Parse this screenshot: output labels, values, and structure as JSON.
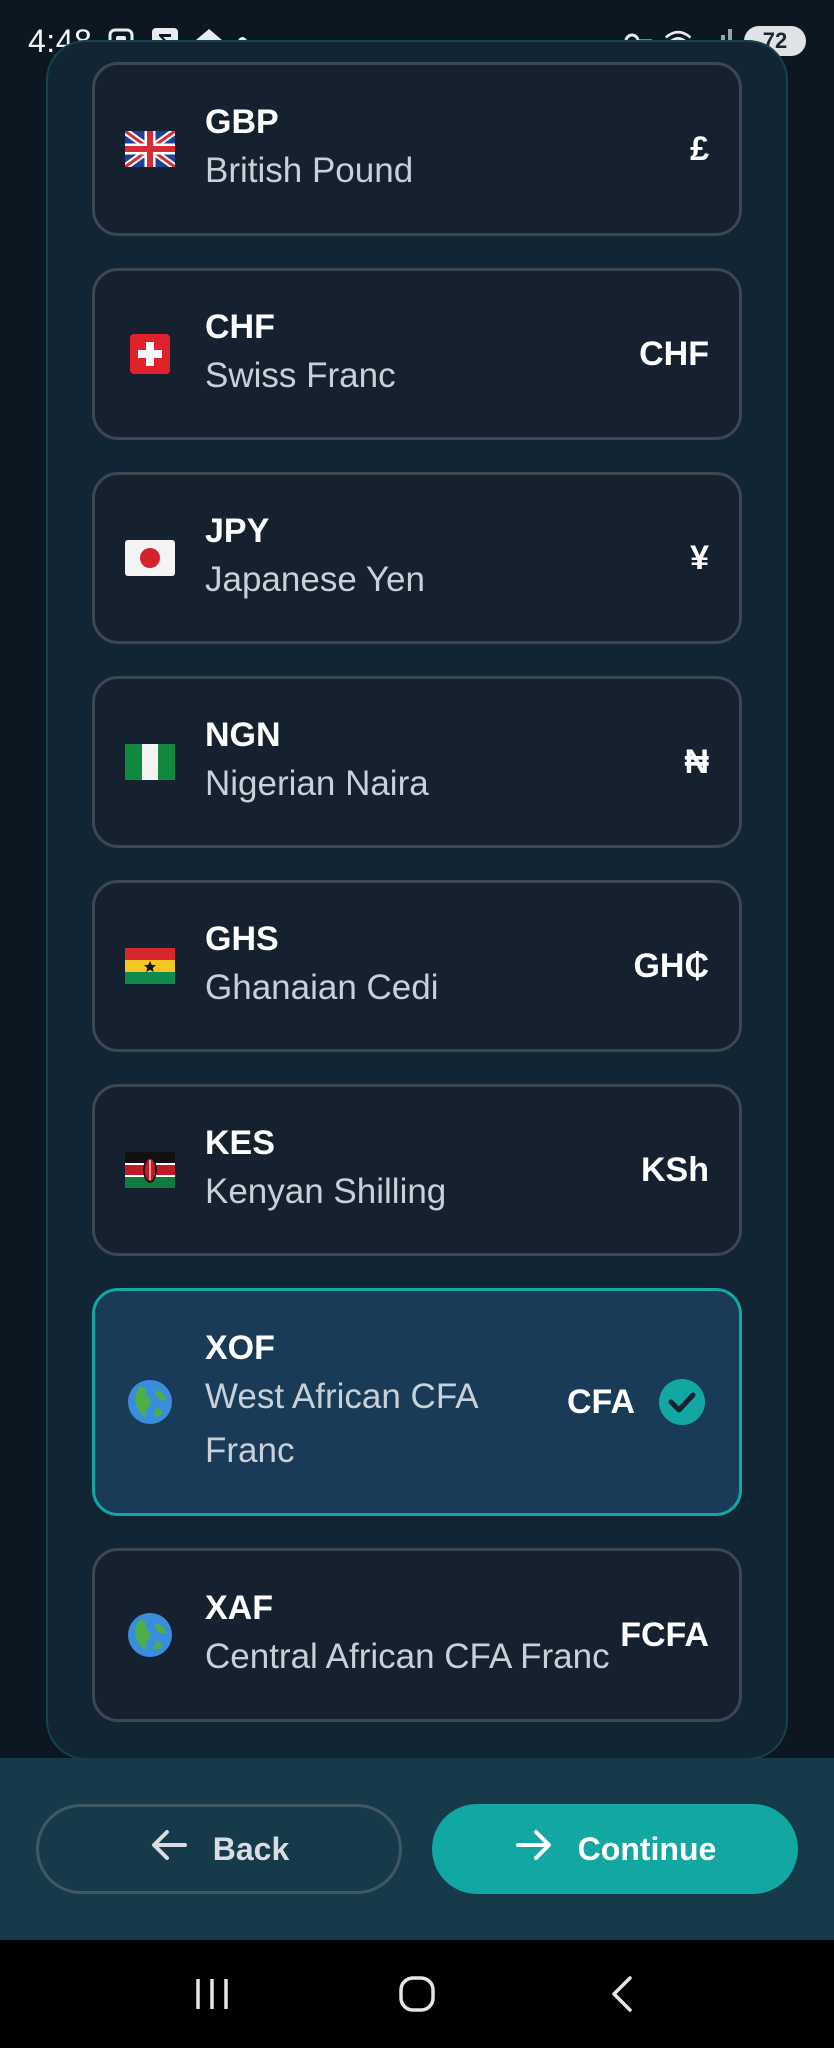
{
  "status_bar": {
    "time": "4:48",
    "battery": "72",
    "icons": [
      "screenshot-icon",
      "sigma-icon",
      "home-icon",
      "vpn-key-icon",
      "wifi-icon",
      "signal-icon"
    ]
  },
  "currencies": [
    {
      "code": "GBP",
      "name": "British Pound",
      "symbol": "£",
      "flag": "uk-flag-icon",
      "selected": false
    },
    {
      "code": "CHF",
      "name": "Swiss Franc",
      "symbol": "CHF",
      "flag": "switzerland-flag-icon",
      "selected": false
    },
    {
      "code": "JPY",
      "name": "Japanese Yen",
      "symbol": "¥",
      "flag": "japan-flag-icon",
      "selected": false
    },
    {
      "code": "NGN",
      "name": "Nigerian Naira",
      "symbol": "₦",
      "flag": "nigeria-flag-icon",
      "selected": false
    },
    {
      "code": "GHS",
      "name": "Ghanaian Cedi",
      "symbol": "GH₵",
      "flag": "ghana-flag-icon",
      "selected": false
    },
    {
      "code": "KES",
      "name": "Kenyan Shilling",
      "symbol": "KSh",
      "flag": "kenya-flag-icon",
      "selected": false
    },
    {
      "code": "XOF",
      "name_line1": "West African CFA",
      "name_line2": "Franc",
      "symbol": "CFA",
      "flag": "globe-icon",
      "selected": true
    },
    {
      "code": "XAF",
      "name": "Central African CFA Franc",
      "symbol": "FCFA",
      "flag": "globe-icon",
      "selected": false
    }
  ],
  "actions": {
    "back_label": "Back",
    "continue_label": "Continue"
  },
  "colors": {
    "accent": "#12a7a3",
    "background": "#0c1722",
    "card": "#15212f",
    "selected_card": "#1a3b57"
  }
}
